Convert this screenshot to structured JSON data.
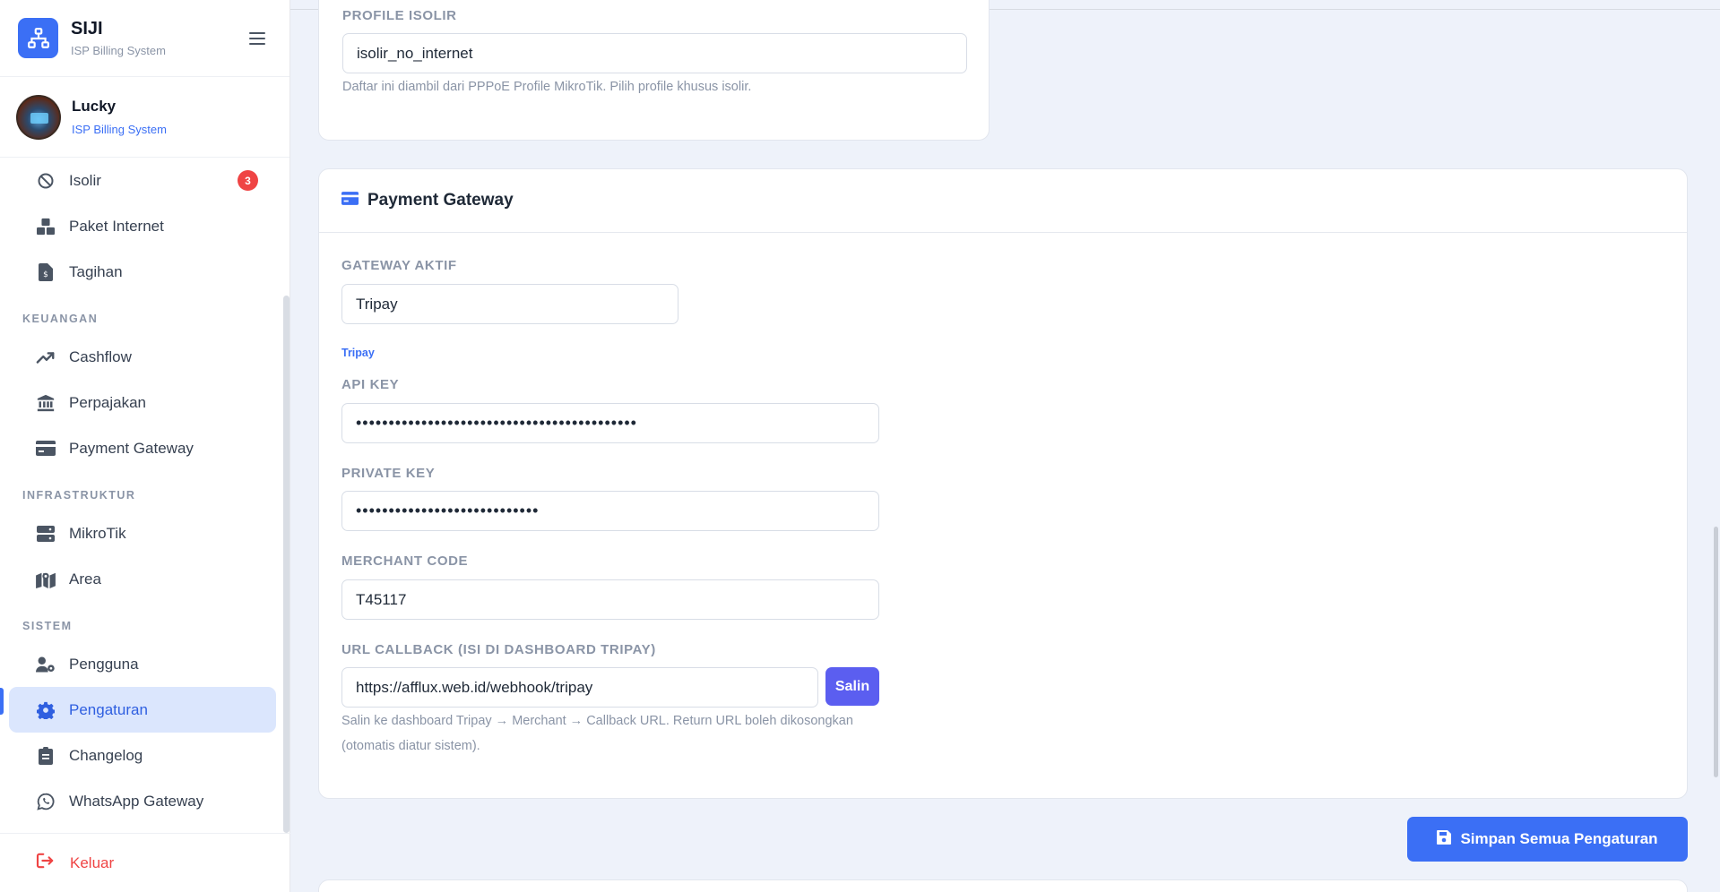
{
  "brand": {
    "name": "SIJI",
    "subtitle": "ISP Billing System"
  },
  "user": {
    "name": "Lucky",
    "subtitle": "ISP Billing System"
  },
  "sidebar": {
    "items_top": [
      {
        "label": "Isolir",
        "icon": "ban-icon",
        "badge": "3"
      },
      {
        "label": "Paket Internet",
        "icon": "boxes-icon"
      },
      {
        "label": "Tagihan",
        "icon": "invoice-icon"
      }
    ],
    "section_keuangan": "KEUANGAN",
    "items_keuangan": [
      {
        "label": "Cashflow",
        "icon": "trend-up-icon"
      },
      {
        "label": "Perpajakan",
        "icon": "bank-icon"
      },
      {
        "label": "Payment Gateway",
        "icon": "credit-card-icon"
      }
    ],
    "section_infra": "INFRASTRUKTUR",
    "items_infra": [
      {
        "label": "MikroTik",
        "icon": "server-icon"
      },
      {
        "label": "Area",
        "icon": "map-icon"
      }
    ],
    "section_sistem": "SISTEM",
    "items_sistem": [
      {
        "label": "Pengguna",
        "icon": "user-gear-icon"
      },
      {
        "label": "Pengaturan",
        "icon": "gear-icon",
        "active": true
      },
      {
        "label": "Changelog",
        "icon": "clipboard-icon"
      },
      {
        "label": "WhatsApp Gateway",
        "icon": "whatsapp-icon"
      }
    ],
    "logout": "Keluar"
  },
  "isolir_card": {
    "label": "PROFILE ISOLIR",
    "value": "isolir_no_internet",
    "hint": "Daftar ini diambil dari PPPoE Profile MikroTik. Pilih profile khusus isolir."
  },
  "payment_gateway": {
    "title": "Payment Gateway",
    "gateway_label": "GATEWAY AKTIF",
    "gateway_value": "Tripay",
    "provider_label": "Tripay",
    "api_key_label": "API KEY",
    "api_key_value": "•••••••••••••••••••••••••••••••••••••••••••",
    "private_key_label": "PRIVATE KEY",
    "private_key_value": "••••••••••••••••••••••••••••",
    "merchant_label": "MERCHANT CODE",
    "merchant_value": "T45117",
    "callback_label": "URL CALLBACK (ISI DI DASHBOARD TRIPAY)",
    "callback_value": "https://afflux.web.id/webhook/tripay",
    "copy_button": "Salin",
    "callback_hint_line1": "Salin ke dashboard Tripay → Merchant → Callback URL. Return URL boleh dikosongkan",
    "callback_hint_line2": "(otomatis diatur sistem)."
  },
  "save_button": "Simpan Semua Pengaturan",
  "colors": {
    "primary": "#3b6ff5",
    "badge": "#ef4444",
    "copy": "#5b5ef0",
    "background": "#eef2fa"
  }
}
